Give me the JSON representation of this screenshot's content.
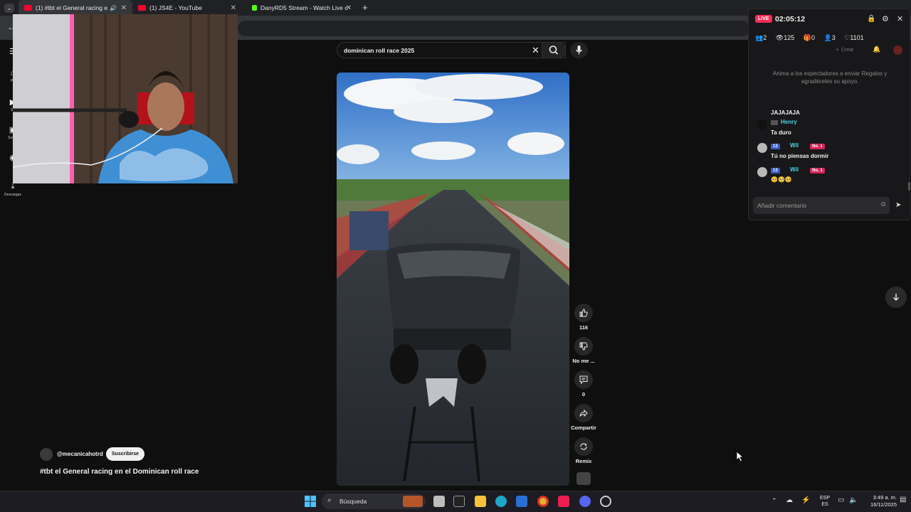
{
  "browser": {
    "tabs": [
      {
        "title": "(1) #tbt el General racing e",
        "active": true,
        "icon": "youtube-icon",
        "audio": true
      },
      {
        "title": "(1) JS4E - YouTube",
        "active": false,
        "icon": "youtube-icon"
      },
      {
        "title": "DanyRD5 Stream - Watch Live c",
        "active": false,
        "icon": "kick-icon"
      }
    ],
    "new_tab_symbol": "+"
  },
  "youtube": {
    "rail": [
      {
        "label": "Pri",
        "icon": "home-icon"
      },
      {
        "label": "Sh",
        "icon": "shorts-icon"
      },
      {
        "label": "Suscri",
        "icon": "subscriptions-icon"
      },
      {
        "label": "",
        "icon": "you-icon"
      },
      {
        "label": "Descargas",
        "icon": "download-icon"
      }
    ],
    "search": {
      "query": "dominican roll race 2025"
    },
    "actions": {
      "like_count": "116",
      "dislike_label": "No me ...",
      "comment_count": "0",
      "share_label": "Compartir",
      "remix_label": "Remix"
    },
    "channel": {
      "handle": "@mecanicahotrd",
      "subscribe_label": "Suscribirse"
    },
    "video_title": "#tbt el General racing en el Dominican roll race"
  },
  "live_panel": {
    "live_badge": "LIVE",
    "duration": "02:05:12",
    "stats": {
      "guests": "2",
      "viewers": "125",
      "gifts": "0",
      "followers": "3",
      "likes": "1101"
    },
    "create_label": "Crear",
    "prompt": "Anima a los espectadores a enviar Regalos y agradéceles su apoyo.",
    "messages": [
      {
        "user": "",
        "text": "JAJAJAJA",
        "badges": []
      },
      {
        "user": "Henry",
        "text": "Ta duro",
        "badges": []
      },
      {
        "user": "Wil",
        "text": "Tú no piensas dormir",
        "badges": [
          "13",
          "No. 1"
        ]
      },
      {
        "user": "Wil",
        "text": "🥺🥺🥺",
        "badges": [
          "13",
          "No. 1"
        ]
      }
    ],
    "comment_placeholder": "Añadir comentario"
  },
  "taskbar": {
    "search_placeholder": "Búsqueda",
    "language": "ESP",
    "region": "ES",
    "time": "3:49 a. m.",
    "date": "16/11/2025"
  },
  "colors": {
    "live_red": "#fe2c55",
    "badge_blue": "#3a5ccc",
    "badge_pink": "#d6245a",
    "subscribe_bg": "#f1f1f1",
    "kick_green": "#53fc18",
    "youtube_red": "#ff0033"
  }
}
